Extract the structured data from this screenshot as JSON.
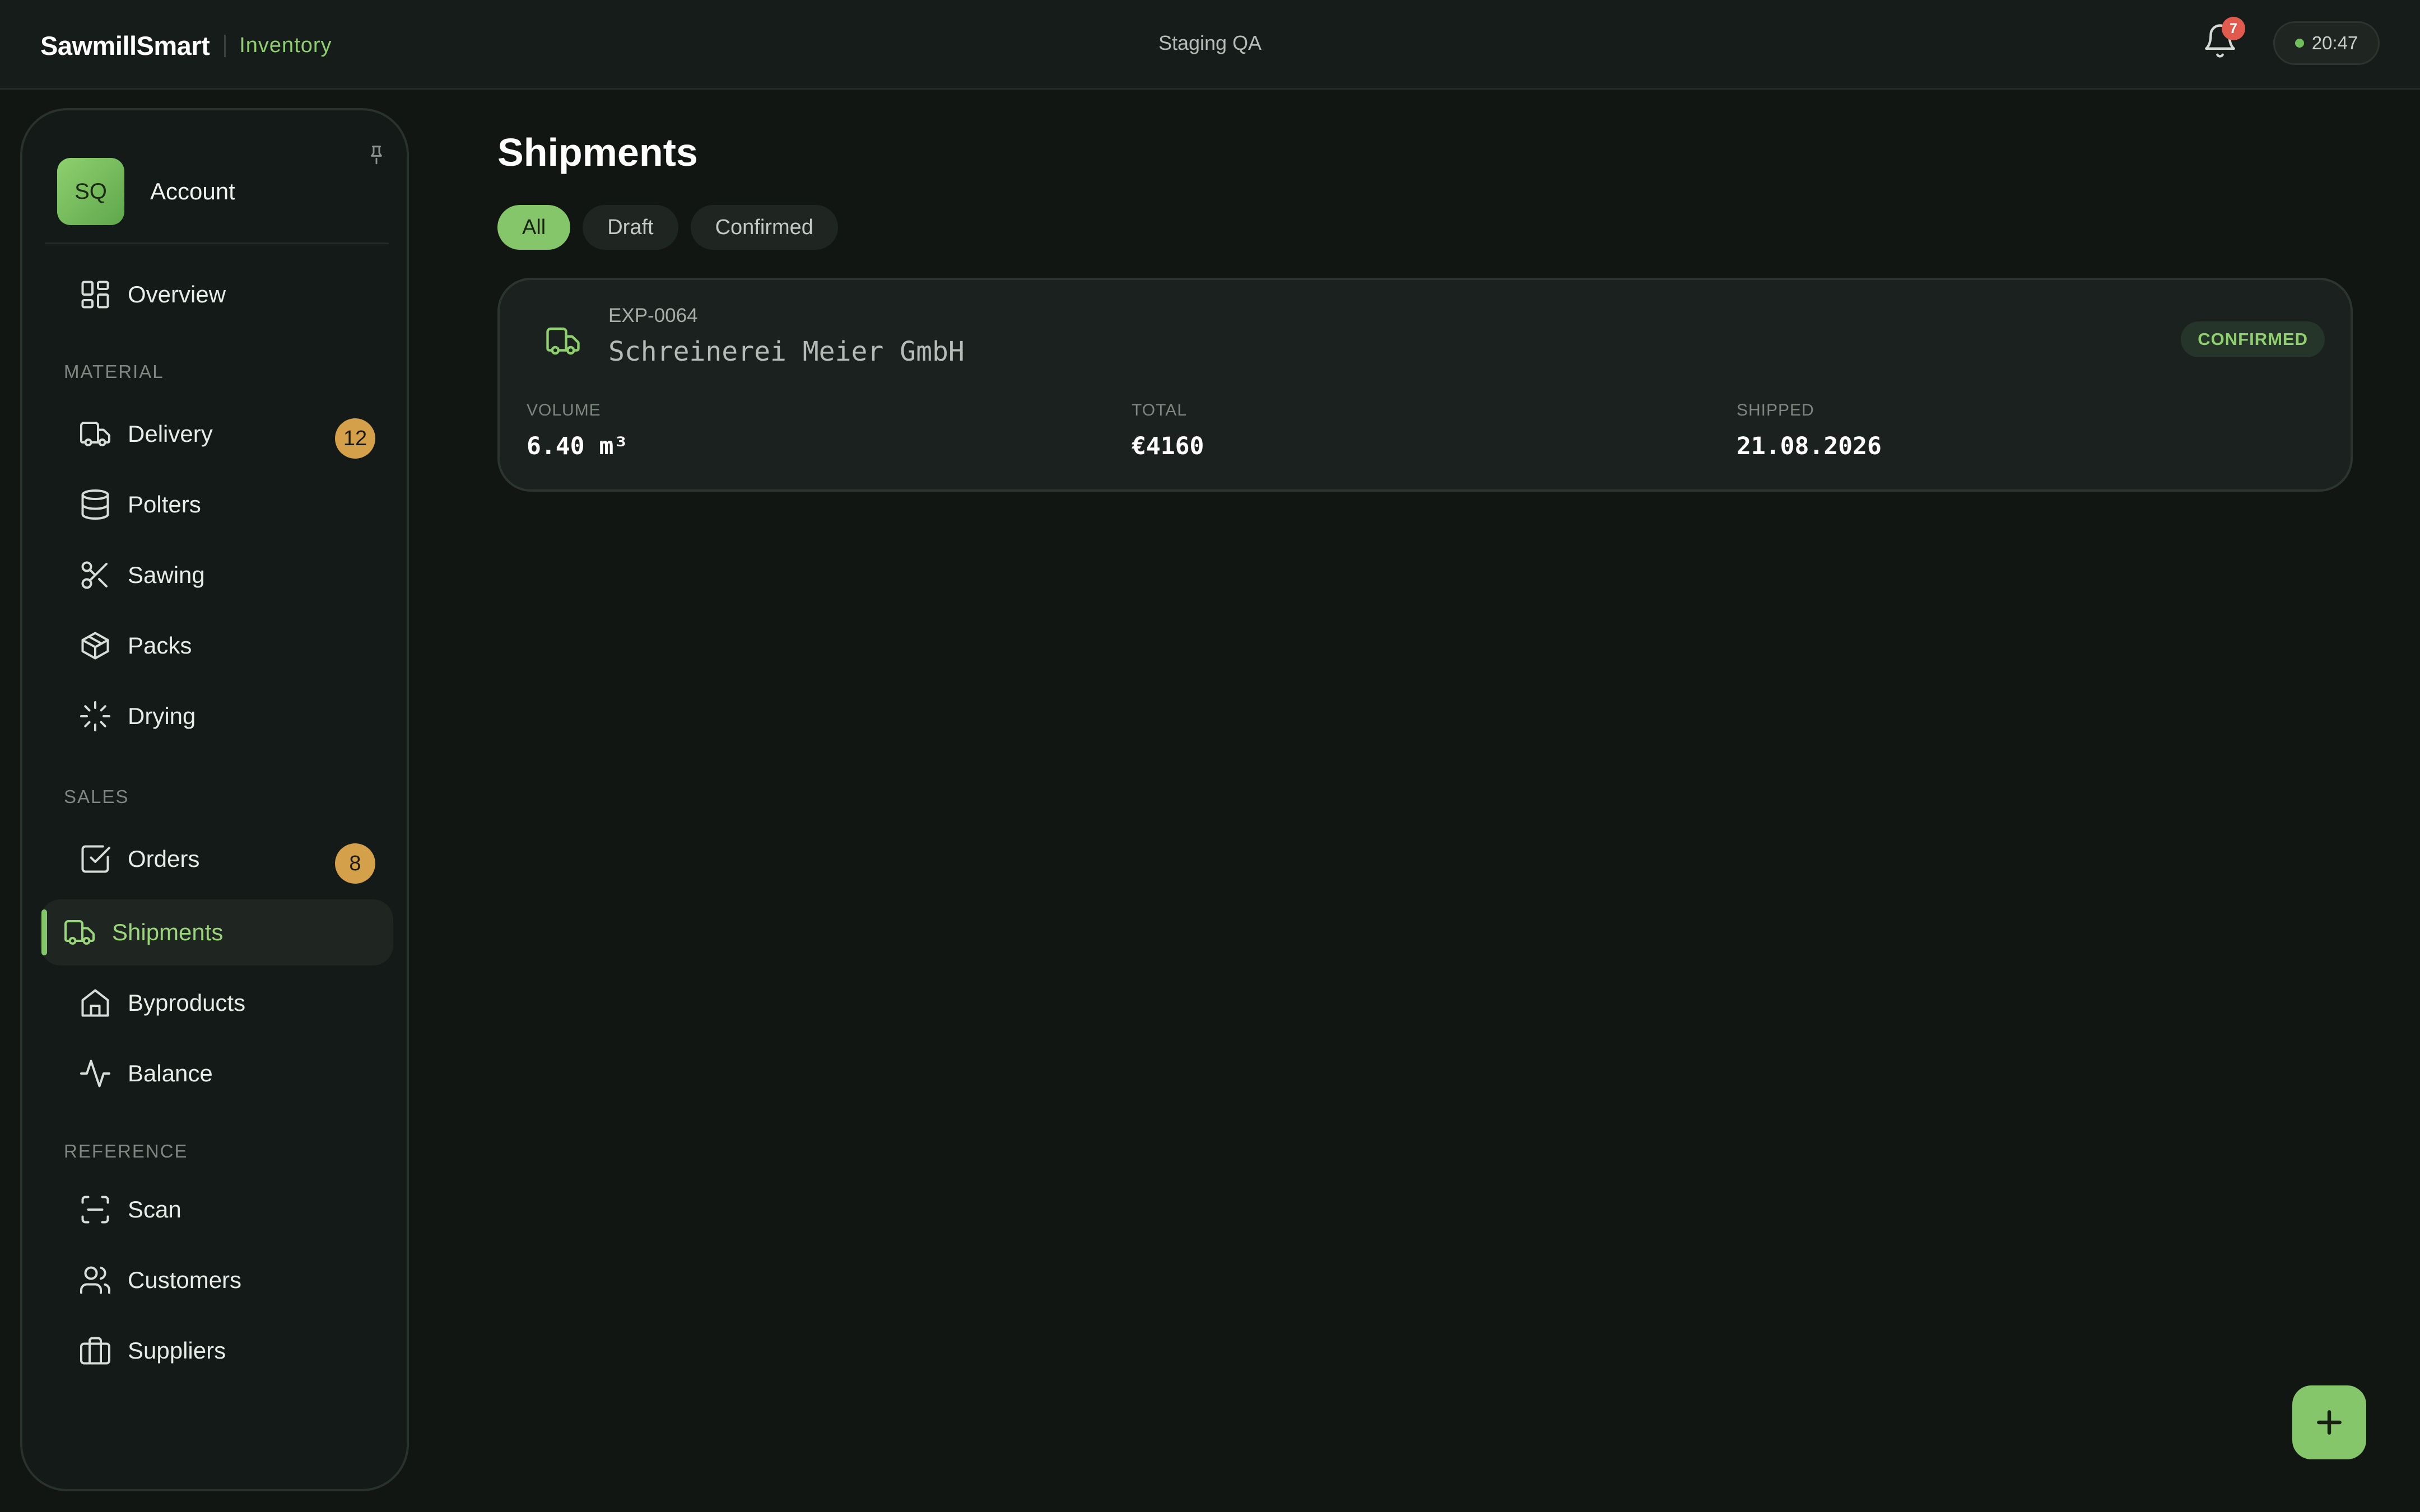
{
  "app": {
    "name": "SawmillSmart",
    "section": "Inventory",
    "environment": "Staging QA"
  },
  "header": {
    "notifications_count": "7",
    "clock": "20:47"
  },
  "account": {
    "initials": "SQ",
    "label": "Account"
  },
  "nav": {
    "overview": {
      "label": "Overview",
      "icon": "grid-icon"
    },
    "sections": [
      {
        "title": "MATERIAL",
        "items": [
          {
            "label": "Delivery",
            "icon": "truck-icon",
            "badge": "12"
          },
          {
            "label": "Polters",
            "icon": "database-icon"
          },
          {
            "label": "Sawing",
            "icon": "scissors-icon"
          },
          {
            "label": "Packs",
            "icon": "box-icon"
          },
          {
            "label": "Drying",
            "icon": "loader-icon"
          }
        ]
      },
      {
        "title": "SALES",
        "items": [
          {
            "label": "Orders",
            "icon": "check-square-icon",
            "badge": "8"
          },
          {
            "label": "Shipments",
            "icon": "truck-icon",
            "active": true
          },
          {
            "label": "Byproducts",
            "icon": "home-icon"
          },
          {
            "label": "Balance",
            "icon": "activity-icon"
          }
        ]
      },
      {
        "title": "REFERENCE",
        "items": [
          {
            "label": "Scan",
            "icon": "scan-icon"
          },
          {
            "label": "Customers",
            "icon": "users-icon"
          },
          {
            "label": "Suppliers",
            "icon": "briefcase-icon"
          }
        ]
      }
    ]
  },
  "main": {
    "title": "Shipments",
    "filters": [
      {
        "label": "All",
        "selected": true
      },
      {
        "label": "Draft"
      },
      {
        "label": "Confirmed"
      }
    ],
    "shipments": [
      {
        "id": "EXP-0064",
        "customer": "Schreinerei Meier GmbH",
        "status": "CONFIRMED",
        "stats": [
          {
            "label": "VOLUME",
            "value": "6.40 m³"
          },
          {
            "label": "TOTAL",
            "value": "€4160"
          },
          {
            "label": "SHIPPED",
            "value": "21.08.2026"
          }
        ]
      }
    ]
  },
  "colors": {
    "accent": "#86c66a",
    "badge": "#d4a14a",
    "alert": "#e05a4e",
    "background": "#111613"
  }
}
